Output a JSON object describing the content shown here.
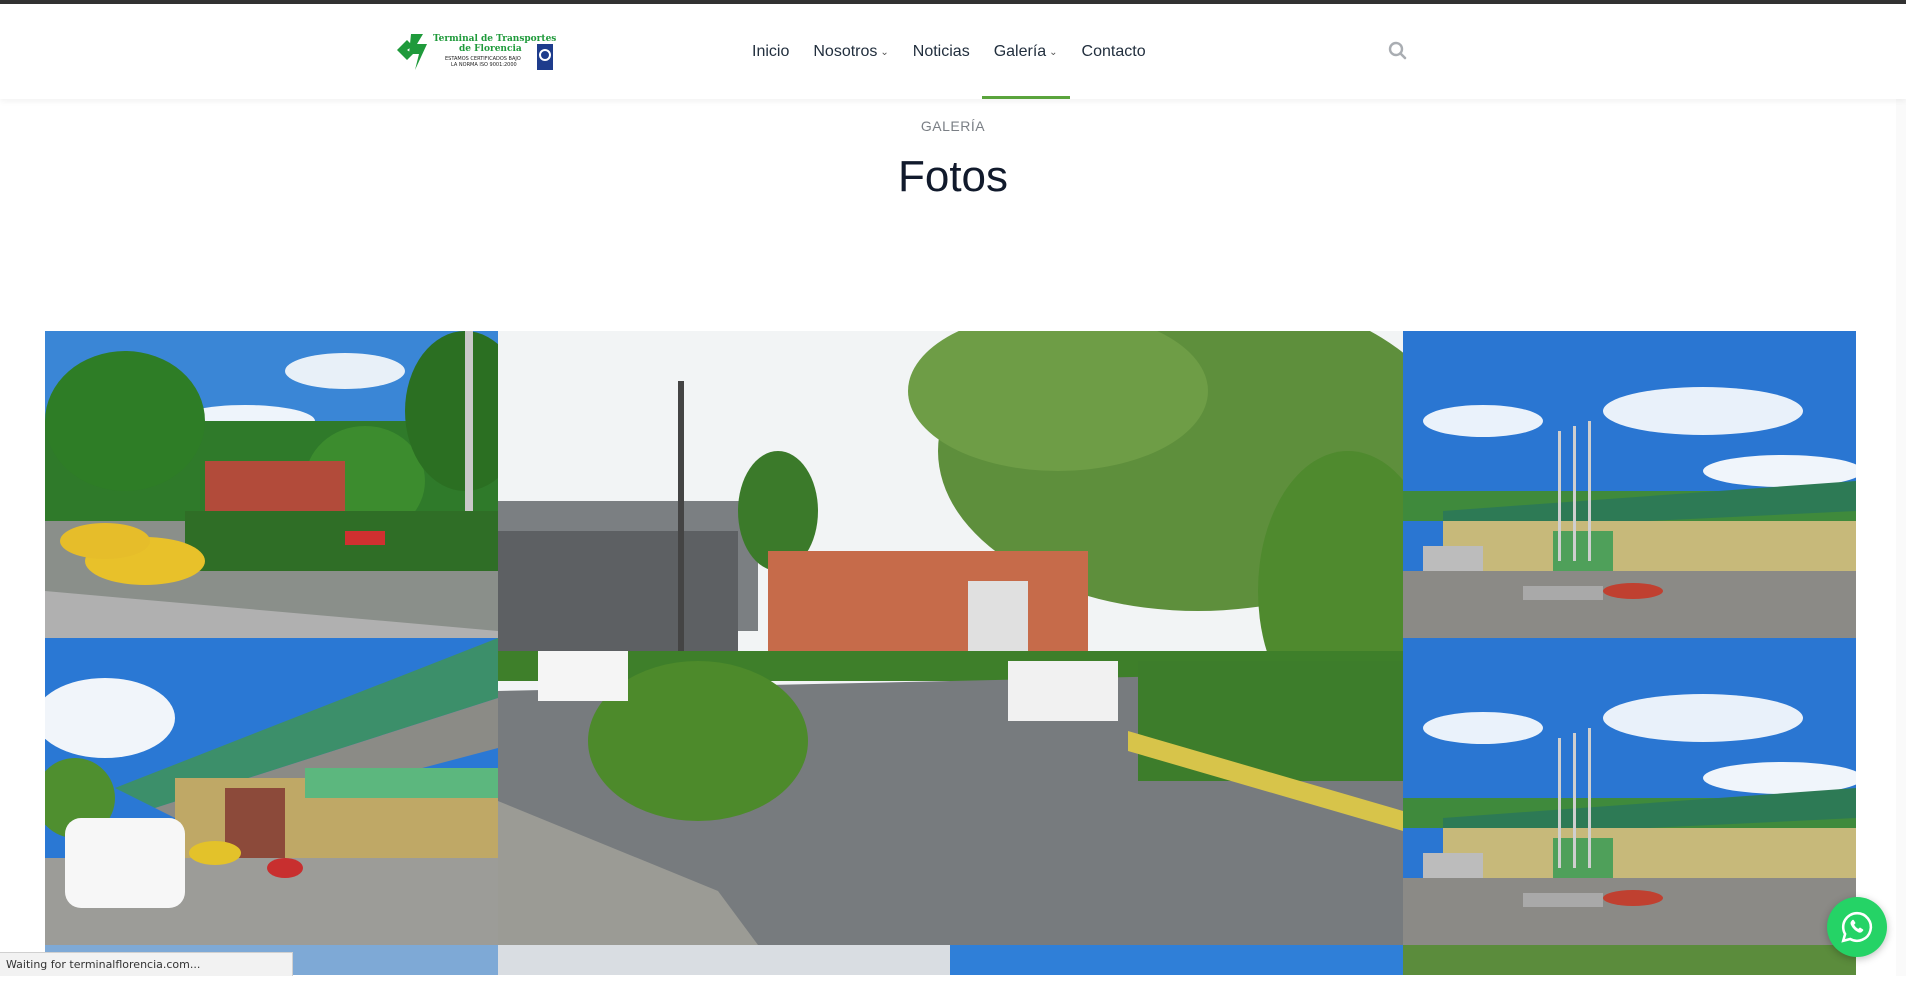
{
  "brand": {
    "logo_line1": "Terminal de Transportes",
    "logo_line2": "de Florencia",
    "logo_line3": "ESTAMOS CERTIFICADOS BAJO",
    "logo_line4": "LA NORMA ISO 9001:2000",
    "primary_color": "#1f9a3b",
    "accent_color": "#5aa43c"
  },
  "nav": {
    "items": [
      {
        "label": "Inicio",
        "has_dropdown": false,
        "active": false
      },
      {
        "label": "Nosotros",
        "has_dropdown": true,
        "active": false
      },
      {
        "label": "Noticias",
        "has_dropdown": false,
        "active": false
      },
      {
        "label": "Galería",
        "has_dropdown": true,
        "active": true
      },
      {
        "label": "Contacto",
        "has_dropdown": false,
        "active": false
      }
    ],
    "search_icon": "search-icon"
  },
  "page": {
    "subtitle": "GALERÍA",
    "title": "Fotos"
  },
  "gallery": {
    "photos": [
      {
        "name": "photo-taxis-parking",
        "description_icon": "image"
      },
      {
        "name": "photo-road-entrance",
        "description_icon": "image"
      },
      {
        "name": "photo-terminal-flags",
        "description_icon": "image"
      },
      {
        "name": "photo-terminal-canopy",
        "description_icon": "image"
      },
      {
        "name": "photo-terminal-flags-2",
        "description_icon": "image"
      }
    ]
  },
  "status_bar": {
    "text": "Waiting for terminalflorencia.com..."
  },
  "whatsapp": {
    "icon": "whatsapp-icon",
    "color": "#25d366"
  }
}
